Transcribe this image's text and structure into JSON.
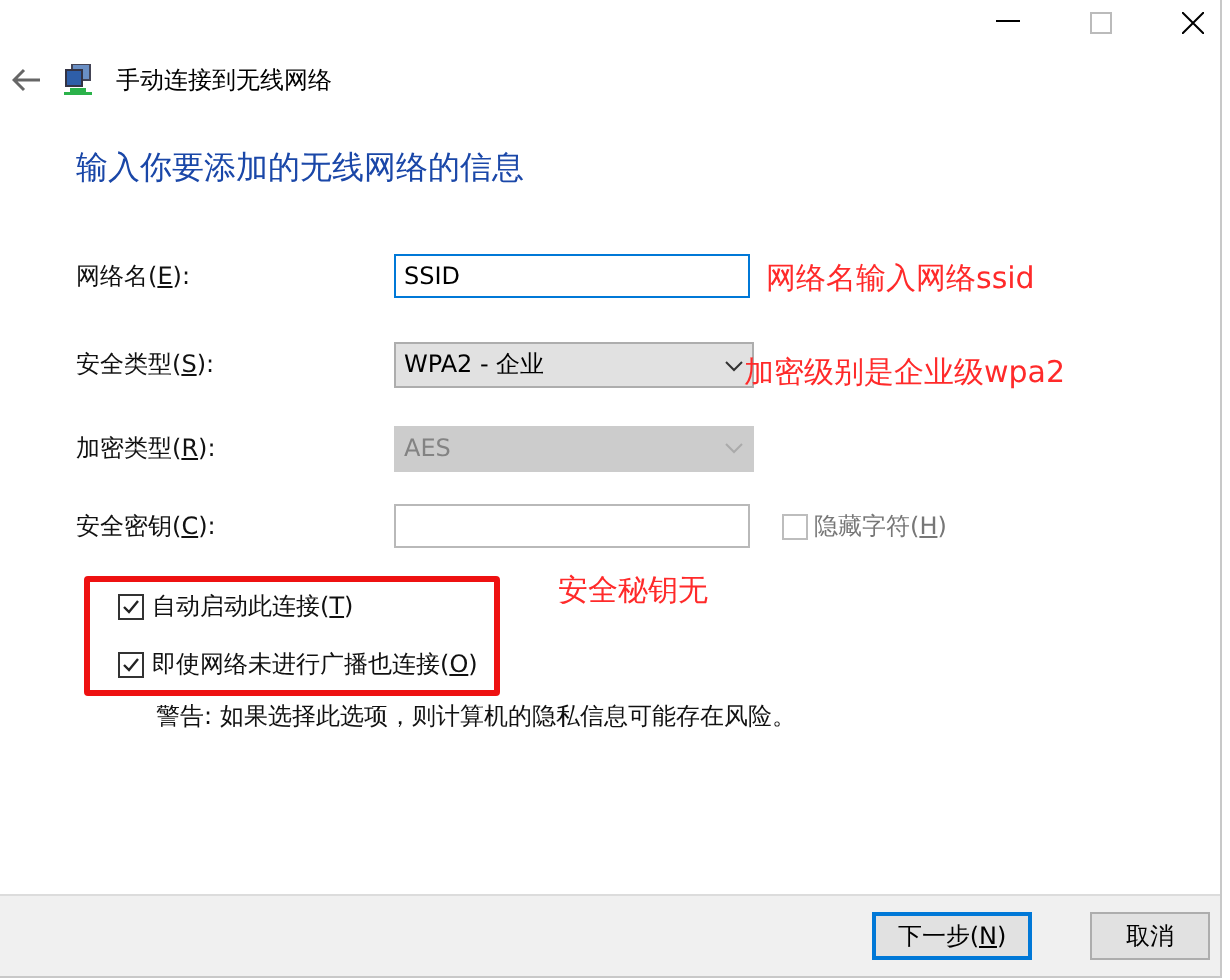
{
  "window": {
    "title": "手动连接到无线网络"
  },
  "heading": "输入你要添加的无线网络的信息",
  "fields": [
    {
      "kind": "text",
      "label": {
        "before": "网络名(",
        "key": "E",
        "after": "):"
      },
      "value": "SSID",
      "focused": true
    },
    {
      "kind": "select",
      "label": {
        "before": "安全类型(",
        "key": "S",
        "after": "):"
      },
      "value": "WPA2 - 企业",
      "disabled": false
    },
    {
      "kind": "select",
      "label": {
        "before": "加密类型(",
        "key": "R",
        "after": "):"
      },
      "value": "AES",
      "disabled": true
    },
    {
      "kind": "password",
      "label": {
        "before": "安全密钥(",
        "key": "C",
        "after": "):"
      },
      "focused": false,
      "option": {
        "label": {
          "before": "隐藏字符(",
          "key": "H",
          "after": ")"
        },
        "checked": false,
        "disabled": true
      }
    }
  ],
  "checkboxes": [
    {
      "label": {
        "before": "自动启动此连接(",
        "key": "T",
        "after": ")"
      },
      "checked": true
    },
    {
      "label": {
        "before": "即使网络未进行广播也连接(",
        "key": "O",
        "after": ")"
      },
      "checked": true
    }
  ],
  "warning": "警告: 如果选择此选项，则计算机的隐私信息可能存在风险。",
  "annotations": [
    "网络名输入网络ssid",
    "加密级别是企业级wpa2",
    "安全秘钥无"
  ],
  "buttons": [
    {
      "label": {
        "before": "下一步(",
        "key": "N",
        "after": ")"
      },
      "default": true
    },
    {
      "label": {
        "before": "取消"
      },
      "default": false
    }
  ]
}
